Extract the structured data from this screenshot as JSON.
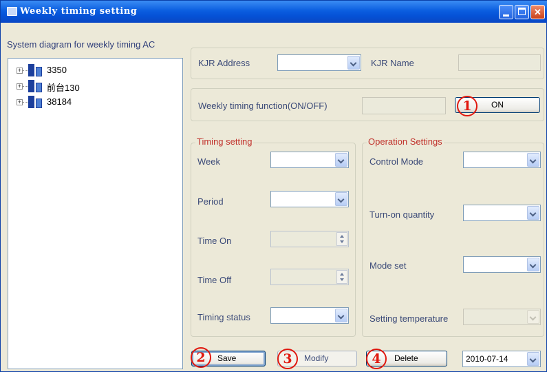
{
  "window": {
    "title": "Weekly timing setting"
  },
  "tree": {
    "label": "System diagram for weekly timing AC",
    "items": [
      {
        "label": "3350"
      },
      {
        "label": "前台130"
      },
      {
        "label": "38184"
      }
    ]
  },
  "kjr": {
    "address_label": "KJR Address",
    "address_value": "",
    "name_label": "KJR Name",
    "name_value": ""
  },
  "weekly": {
    "label": "Weekly timing function(ON/OFF)",
    "status_value": "",
    "on_button": "ON"
  },
  "timing": {
    "legend": "Timing setting",
    "week_label": "Week",
    "period_label": "Period",
    "time_on_label": "Time On",
    "time_off_label": "Time Off",
    "status_label": "Timing status"
  },
  "operation": {
    "legend": "Operation Settings",
    "control_mode_label": "Control Mode",
    "turn_on_label": "Turn-on quantity",
    "mode_set_label": "Mode set",
    "setting_temp_label": "Setting temperature"
  },
  "actions": {
    "save": "Save",
    "modify": "Modify",
    "delete": "Delete",
    "date": "2010-07-14"
  },
  "markers": [
    "1",
    "2",
    "3",
    "4"
  ],
  "colors": {
    "marker": "#e0180f",
    "legend": "#c0302a",
    "titlebar": "#0b5ee0"
  }
}
